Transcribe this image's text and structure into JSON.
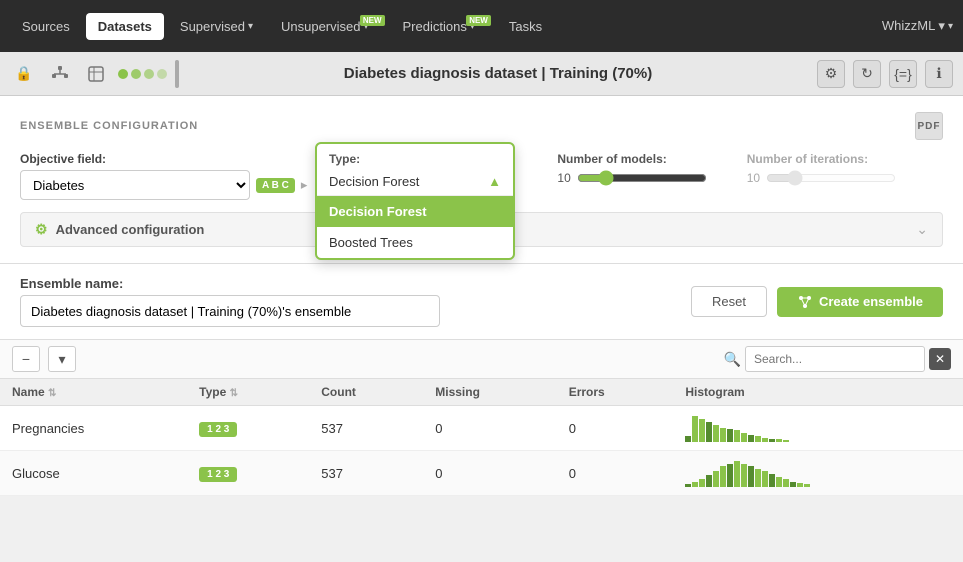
{
  "nav": {
    "items": [
      {
        "id": "sources",
        "label": "Sources",
        "active": false,
        "new": false
      },
      {
        "id": "datasets",
        "label": "Datasets",
        "active": true,
        "new": false
      },
      {
        "id": "supervised",
        "label": "Supervised",
        "active": false,
        "new": false
      },
      {
        "id": "unsupervised",
        "label": "Unsupervised",
        "active": false,
        "new": true
      },
      {
        "id": "predictions",
        "label": "Predictions",
        "active": false,
        "new": true
      },
      {
        "id": "tasks",
        "label": "Tasks",
        "active": false,
        "new": false
      }
    ],
    "right_label": "WhizzML ▾"
  },
  "toolbar": {
    "title": "Diabetes diagnosis dataset | Training (70%)"
  },
  "config": {
    "section_title": "ENSEMBLE CONFIGURATION",
    "objective_label": "Objective field:",
    "objective_value": "Diabetes",
    "type_label": "Type:",
    "type_selected": "Decision Forest",
    "type_options": [
      "Decision Forest",
      "Boosted Trees"
    ],
    "models_label": "Number of models:",
    "models_value": "10",
    "iterations_label": "Number of iterations:",
    "iterations_value": "10",
    "advanced_label": "Advanced configuration"
  },
  "ensemble": {
    "name_label": "Ensemble name:",
    "name_value": "Diabetes diagnosis dataset | Training (70%)'s ensemble",
    "reset_label": "Reset",
    "create_label": "Create ensemble"
  },
  "table": {
    "columns": [
      "Name",
      "Type",
      "Count",
      "Missing",
      "Errors",
      "Histogram"
    ],
    "rows": [
      {
        "name": "Pregnancies",
        "type_badge": "1 2 3",
        "count": "537",
        "missing": "0",
        "errors": "0",
        "histogram": [
          4,
          18,
          16,
          14,
          12,
          10,
          9,
          8,
          6,
          5,
          4,
          3,
          2,
          2,
          1
        ]
      },
      {
        "name": "Glucose",
        "type_badge": "1 2 3",
        "count": "537",
        "missing": "0",
        "errors": "0",
        "histogram": [
          2,
          4,
          6,
          9,
          12,
          16,
          18,
          20,
          18,
          16,
          14,
          12,
          10,
          8,
          6,
          4,
          3,
          2
        ]
      }
    ]
  }
}
